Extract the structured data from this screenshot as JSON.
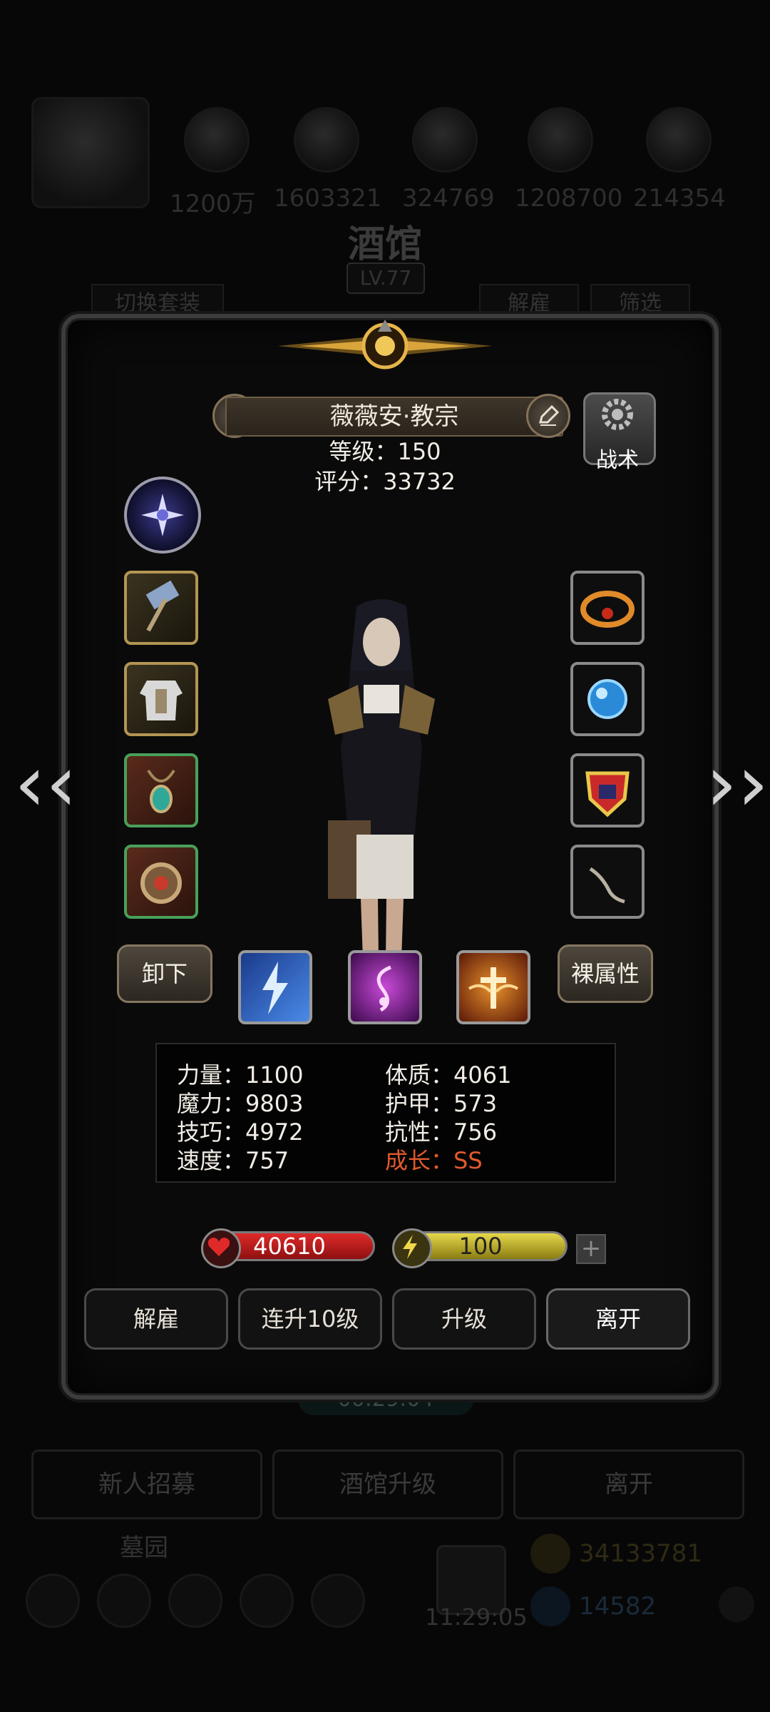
{
  "background": {
    "resources": [
      "1200万",
      "1603321",
      "324769",
      "1208700",
      "214354"
    ],
    "title": "酒馆",
    "level": "LV.77",
    "tabs": [
      "切换套装",
      "解雇",
      "筛选"
    ],
    "timer": "00:29:04",
    "bottom_buttons": [
      "新人招募",
      "酒馆升级",
      "离开"
    ],
    "section_label": "墓园",
    "clock": "11:29:05",
    "currency_1": "34133781",
    "currency_2": "14582"
  },
  "hero": {
    "name": "薇薇安·教宗",
    "level_line": "等级：150",
    "score_line": "评分：33732",
    "tactic_label": "战术"
  },
  "equipment": {
    "left_slots": [
      "hammer-icon",
      "armor-icon",
      "amulet-icon",
      "ring-icon"
    ],
    "right_slots": [
      "flame-icon",
      "orb-icon",
      "rank-badge-icon",
      "staff-icon"
    ]
  },
  "skills": [
    "lightning-skill-icon",
    "music-skill-icon",
    "holy-cross-skill-icon"
  ],
  "buttons": {
    "unequip": "卸下",
    "base_attr": "裸属性",
    "dismiss": "解雇",
    "level_up_10": "连升10级",
    "level_up": "升级",
    "leave": "离开"
  },
  "stats": {
    "strength": "力量：1100",
    "magic": "魔力：9803",
    "skill": "技巧：4972",
    "speed": "速度：757",
    "constitution": "体质：4061",
    "armor": "护甲：573",
    "resistance": "抗性：756",
    "growth": "成长：SS"
  },
  "bars": {
    "hp": "40610",
    "energy": "100",
    "plus": "+"
  },
  "colors": {
    "growth": "#e05a2b",
    "hp": "#c81c1c",
    "energy": "#d8c83a"
  }
}
